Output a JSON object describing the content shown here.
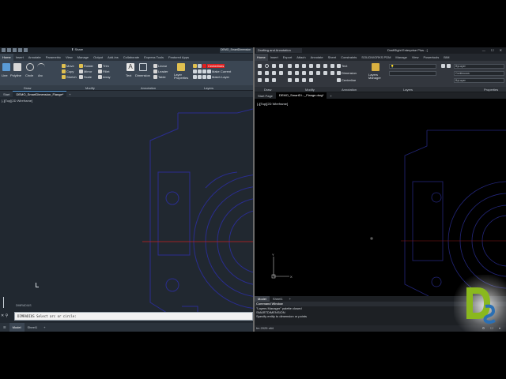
{
  "left": {
    "share_label": "Share",
    "document_title": "DEMO_SmartDimension",
    "ribbon_tabs": [
      "Home",
      "Insert",
      "Annotate",
      "Parametric",
      "View",
      "Manage",
      "Output",
      "Add-ins",
      "Collaborate",
      "Express Tools",
      "Featured Apps"
    ],
    "draw_tools": [
      "Line",
      "Polyline",
      "Circle",
      "Arc"
    ],
    "modify_tools": [
      "Move",
      "Rotate",
      "Trim",
      "Copy",
      "Mirror",
      "Fillet",
      "Stretch",
      "Scale",
      "Array"
    ],
    "annotation_tools": [
      "Text",
      "Dimension",
      "Linear",
      "Leader",
      "Table"
    ],
    "layer_tools": [
      "Layer Properties",
      "Centerlines",
      "Make Current",
      "Match Layer"
    ],
    "panel_titles": [
      "Draw",
      "Modify",
      "Annotation",
      "Layers"
    ],
    "file_tabs": {
      "start": "Start",
      "active": "DEMO_SmartDimension_Flange*",
      "plus": "+"
    },
    "viewport_label": "[-][Top][2D Wireframe]",
    "ucs_label": "DIMRADIUS",
    "command_text": "DIMRADIUS Select arc or circle:",
    "layout_tabs": [
      "Model",
      "Sheet1",
      "+"
    ]
  },
  "right": {
    "workspace": "Drafting and Annotation",
    "app_title": "DraftSight Enterprise Plus - [",
    "ribbon_tabs": [
      "Home",
      "Insert",
      "Export",
      "Attach",
      "Annotate",
      "Sheet",
      "Constraints",
      "SOLIDWORKS PDM",
      "Manage",
      "View",
      "Powertools",
      "BIM"
    ],
    "annotation_tools": [
      "Text",
      "Dimension",
      "Centerline"
    ],
    "layer_manager_label": "Layers Manager",
    "layer_fields": [
      "ByLayer",
      "Continuous",
      "ByLayer"
    ],
    "panel_titles": [
      "Draw",
      "Modify",
      "Annotation",
      "Layers",
      "Properties"
    ],
    "file_tabs": [
      "Start Page",
      "DEMO_SmartDi..._Flange.dwg*",
      "+"
    ],
    "viewport_label": "[-][Top][2D Wireframe]",
    "layout_tabs": [
      "Model",
      "Sheet1",
      "+"
    ],
    "command_window": {
      "title": "Command Window",
      "lines": [
        "\"Layers Manager\" palette closed",
        "SMARTDIMENSION",
        "Specify entity to dimension or points"
      ]
    },
    "status": "fm 2025 x64"
  },
  "colors": {
    "geometry": "#2a2d8f",
    "centerline": "#c42020",
    "ucs": "#c8c8c8"
  }
}
